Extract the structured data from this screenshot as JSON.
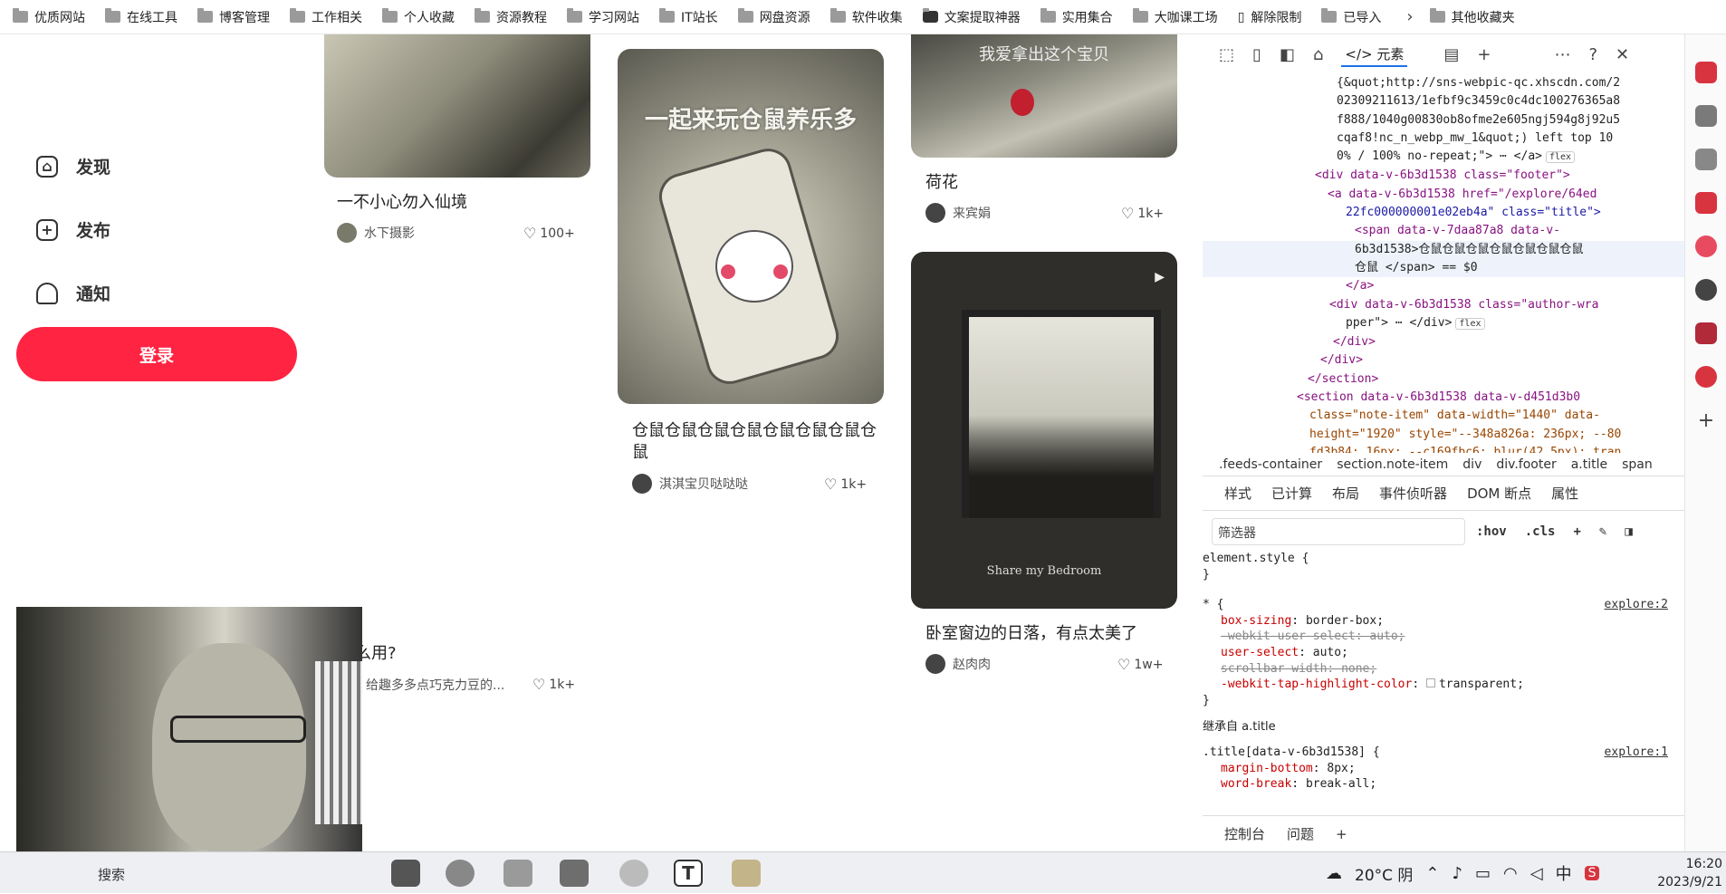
{
  "bookmarks": [
    "优质网站",
    "在线工具",
    "博客管理",
    "工作相关",
    "个人收藏",
    "资源教程",
    "学习网站",
    "IT站长",
    "网盘资源",
    "软件收集",
    "文案提取神器",
    "实用集合",
    "大咖课工场",
    "解除限制",
    "已导入",
    "其他收藏夹"
  ],
  "nav": {
    "discover": "发现",
    "publish": "发布",
    "notify": "通知",
    "login": "登录"
  },
  "cards": [
    {
      "title": "一不小心勿入仙境",
      "author": "水下摄影",
      "likes": "100+"
    },
    {
      "title": "仓鼠仓鼠仓鼠仓鼠仓鼠仓鼠仓鼠仓鼠",
      "author": "淇淇宝贝哒哒哒",
      "likes": "1k+",
      "overlay": "一起来玩仓鼠养乐多"
    },
    {
      "title": "荷花",
      "author": "来宾娟",
      "likes": "1k+",
      "overlay": "我爱拿出这个宝贝"
    },
    {
      "title": "卧室窗边的日落，有点太美了",
      "author": "赵肉肉",
      "likes": "1w+",
      "overlay": "Share my Bedroom"
    },
    {
      "title": "么用?",
      "author": "给趣多多点巧克力豆的...",
      "likes": "1k+"
    }
  ],
  "devtools": {
    "elements_tab": "元素",
    "code_lines": [
      "{&quot;http://sns-webpic-qc.xhscdn.com/2",
      "02309211613/1efbf9c3459c0c4dc100276365a8",
      "f888/1040g00830ob8ofme2e605ngj594g8j92u5",
      "cqaf8!nc_n_webp_mw_1&quot;) left top 10",
      "0% / 100% no-repeat;\"> ⋯ </a>",
      "<div data-v-6b3d1538 class=\"footer\">",
      "<a data-v-6b3d1538 href=\"/explore/64ed",
      "22fc000000001e02eb4a\" class=\"title\">",
      "<span data-v-7daa87a8 data-v-",
      "6b3d1538>仓鼠仓鼠仓鼠仓鼠仓鼠仓鼠仓鼠",
      "仓鼠 </span> == $0",
      "</a>",
      "<div data-v-6b3d1538 class=\"author-wra",
      "pper\"> ⋯ </div>",
      "</div>",
      "</div>",
      "</section>",
      "<section data-v-6b3d1538 data-v-d451d3b0",
      "class=\"note-item\" data-width=\"1440\" data-",
      "height=\"1920\" style=\"--348a826a: 236px; --80",
      "fd3b84: 16px; --c169fbc6: blur(42.5px); tran"
    ],
    "badge": "flex",
    "breadcrumbs": [
      ".feeds-container",
      "section.note-item",
      "div",
      "div.footer",
      "a.title",
      "span"
    ],
    "panel_tabs": [
      "样式",
      "已计算",
      "布局",
      "事件侦听器",
      "DOM 断点",
      "属性"
    ],
    "filter_placeholder": "筛选器",
    "filter_tools": [
      ":hov",
      ".cls"
    ],
    "styles": {
      "element_style": "element.style {",
      "close": "}",
      "universal_selector": "* {",
      "universal_src": "explore:2",
      "props": [
        {
          "name": "box-sizing",
          "value": "border-box;",
          "strike": false
        },
        {
          "name": "-webkit-user-select",
          "value": "auto;",
          "strike": true
        },
        {
          "name": "user-select",
          "value": "auto;",
          "strike": false
        },
        {
          "name": "scrollbar-width",
          "value": "none;",
          "strike": true
        },
        {
          "name": "-webkit-tap-highlight-color",
          "value": "transparent;",
          "strike": false
        }
      ],
      "inherited": "继承自 a.title",
      "title_selector": ".title[data-v-6b3d1538] {",
      "title_src": "explore:1",
      "title_props": [
        {
          "name": "margin-bottom",
          "value": "8px;"
        },
        {
          "name": "word-break",
          "value": "break-all;"
        }
      ]
    },
    "bottom_tabs": [
      "控制台",
      "问题"
    ]
  },
  "taskbar": {
    "weather": "20°C 阴",
    "ime": "中",
    "time": "16:20",
    "date": "2023/9/21",
    "search": "搜索"
  },
  "colors": {
    "brand": "#ff2442",
    "devtools_tag": "#881280",
    "devtools_attr": "#994500",
    "devtools_val": "#1a1aa6"
  }
}
